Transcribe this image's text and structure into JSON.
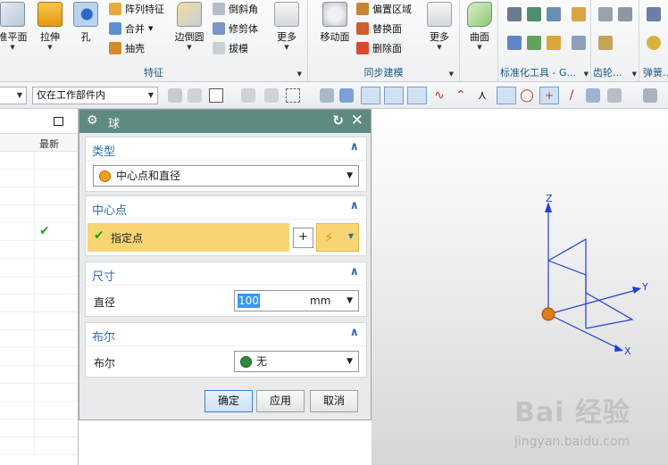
{
  "ribbon": {
    "feature_group": {
      "datum_plane_label": "准平面",
      "extrude_label": "拉伸",
      "hole_label": "孔",
      "pattern_feature_label": "阵列特征",
      "unite_label": "合并",
      "shell_label": "抽壳",
      "edge_blend_label": "边倒圆",
      "chamfer_label": "倒斜角",
      "trim_body_label": "修剪体",
      "draft_label": "拔模",
      "more_label": "更多",
      "title": "特征"
    },
    "sync_group": {
      "move_face_label": "移动面",
      "offset_region_label": "偏置区域",
      "replace_face_label": "替换面",
      "delete_face_label": "删除面",
      "more_label": "更多",
      "title": "同步建模"
    },
    "surface_group": {
      "surface_label": "曲面"
    },
    "standard_group": {
      "title": "标准化工具 - G..."
    },
    "gear_group": {
      "title": "齿轮..."
    },
    "spring_group": {
      "title": "弹簧..."
    }
  },
  "toolbar": {
    "scope_select_value": "仅在工作部件内"
  },
  "nav": {
    "column_header": "最新",
    "check_mark": "✔"
  },
  "dialog": {
    "title": "球",
    "type_section": {
      "label": "类型",
      "value": "中心点和直径"
    },
    "center_section": {
      "label": "中心点",
      "specify_point_label": "指定点"
    },
    "dimension_section": {
      "label": "尺寸",
      "diameter_label": "直径",
      "diameter_value": "100",
      "unit": "mm"
    },
    "boolean_section": {
      "label": "布尔",
      "boolean_label": "布尔",
      "boolean_value": "无"
    },
    "ok_label": "确定",
    "apply_label": "应用",
    "cancel_label": "取消"
  },
  "viewport": {
    "axis_z": "Z",
    "axis_y": "Y",
    "axis_x": "X"
  },
  "watermark": {
    "logo": "Bai 经验",
    "url": "jingyan.baidu.com"
  },
  "colors": {
    "accent_blue": "#2f6fb0",
    "dialog_title": "#5f8a82",
    "highlight": "#f9d472",
    "axis_blue": "#1f3fd8",
    "point_orange": "#e07a1a"
  }
}
